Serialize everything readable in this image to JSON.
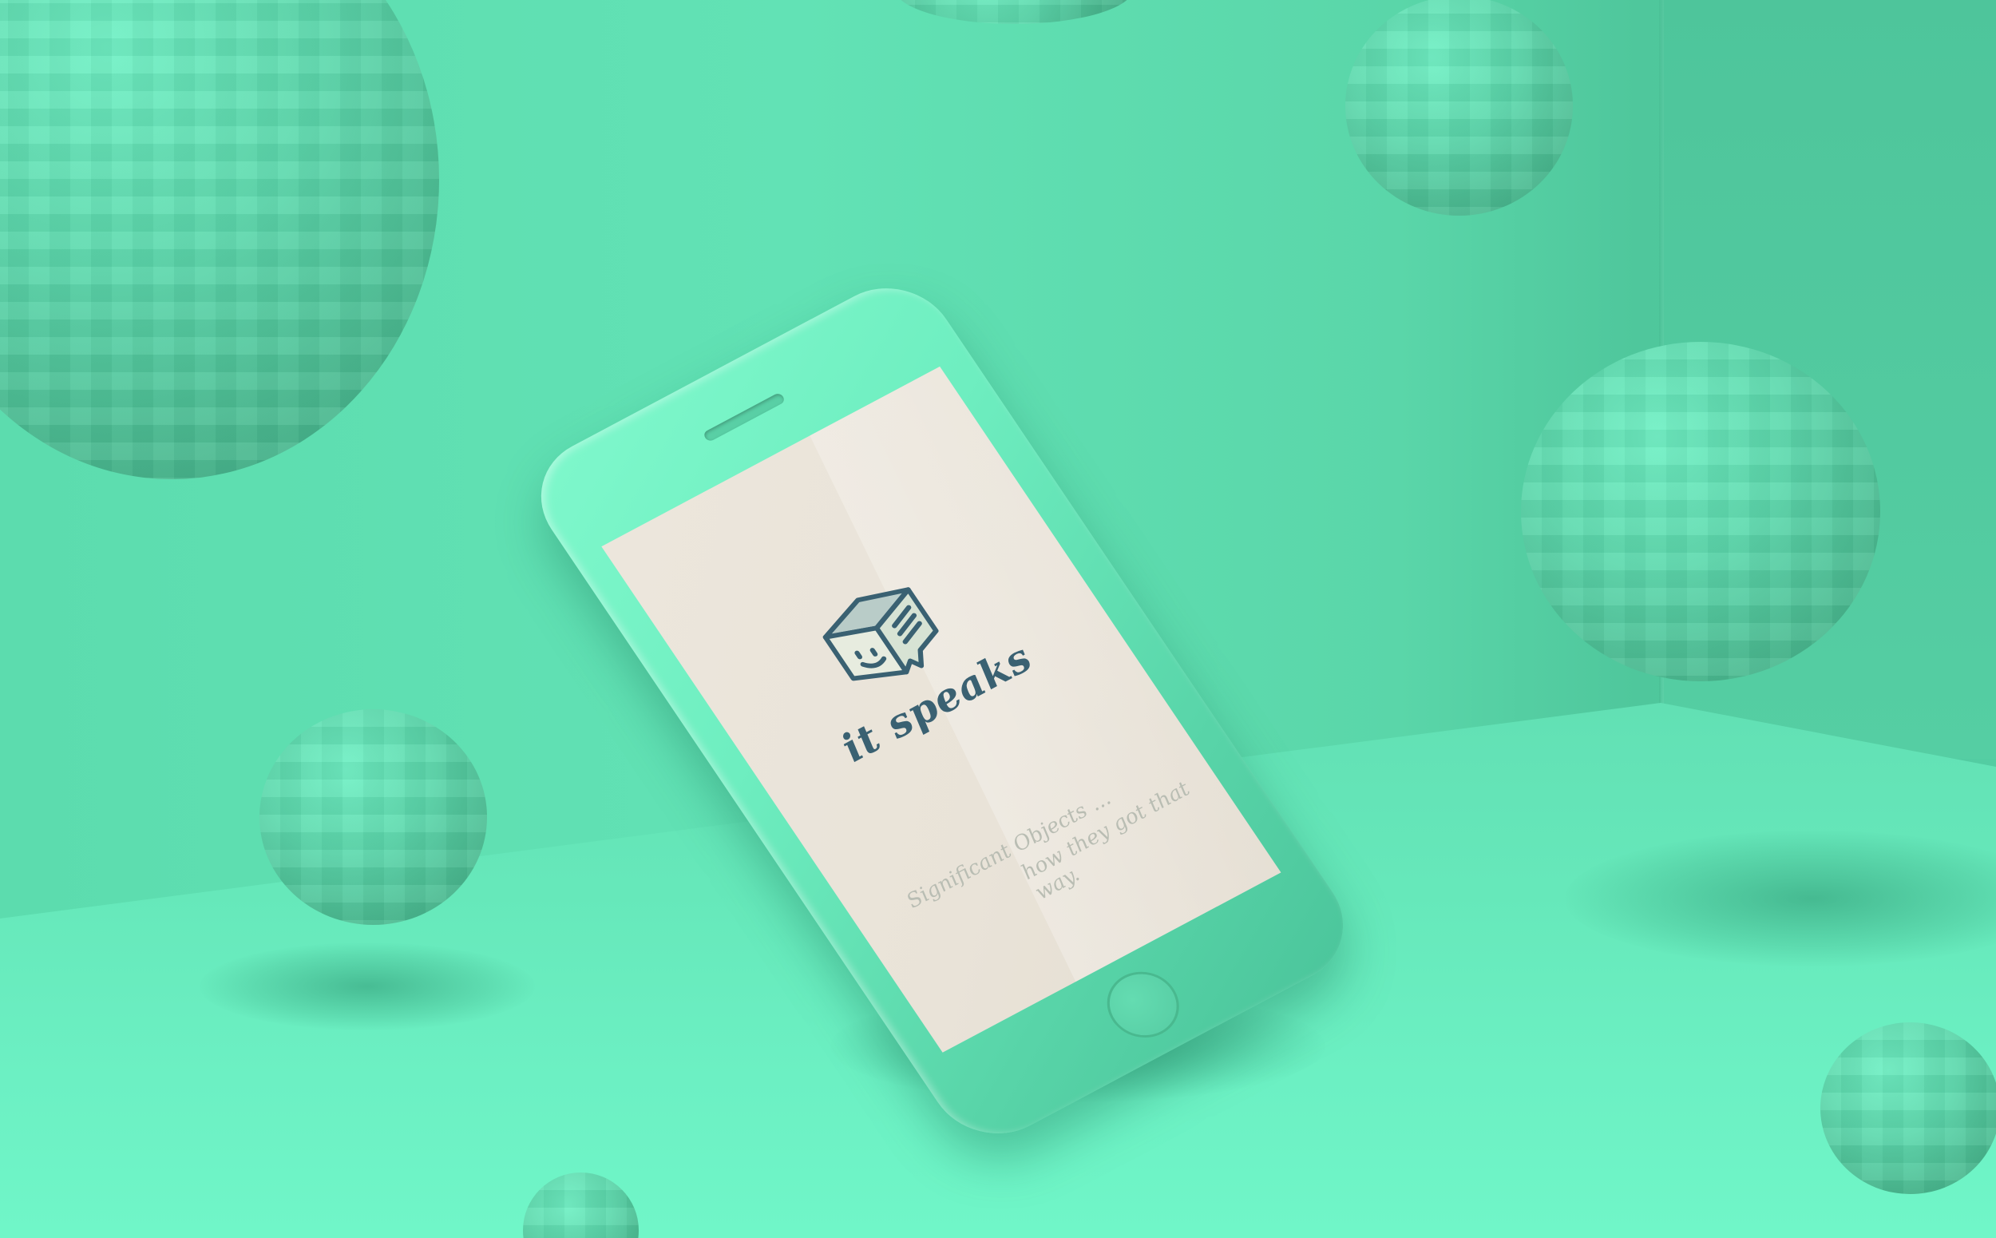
{
  "app": {
    "name": "it speaks",
    "tagline_line1": "Significant Objects ...",
    "tagline_line2": "how they got that way."
  },
  "colors": {
    "background": "#5fe0b2",
    "phone_body": "#6eeec0",
    "screen": "#ece6dc",
    "logo": "#3a6172",
    "tagline": "#b9bdb3"
  },
  "icons": {
    "logo": "box-speech-bubble-icon"
  }
}
